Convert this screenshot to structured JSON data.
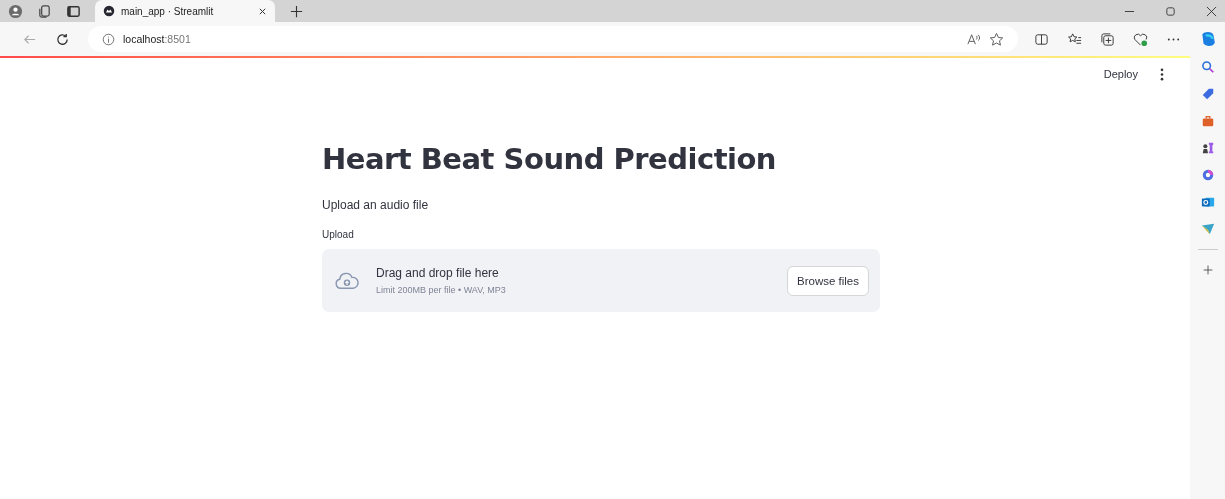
{
  "browser": {
    "tabs": [
      {
        "title": "main_app · Streamlit",
        "selected": true
      }
    ],
    "address": {
      "host": "localhost",
      "port": ":8501"
    }
  },
  "app": {
    "toolbar": {
      "deploy": "Deploy"
    },
    "title": "Heart Beat Sound Prediction",
    "caption": "Upload an audio file",
    "uploader": {
      "label": "Upload",
      "instruction": "Drag and drop file here",
      "limits": "Limit 200MB per file • WAV, MP3",
      "button": "Browse files"
    }
  }
}
